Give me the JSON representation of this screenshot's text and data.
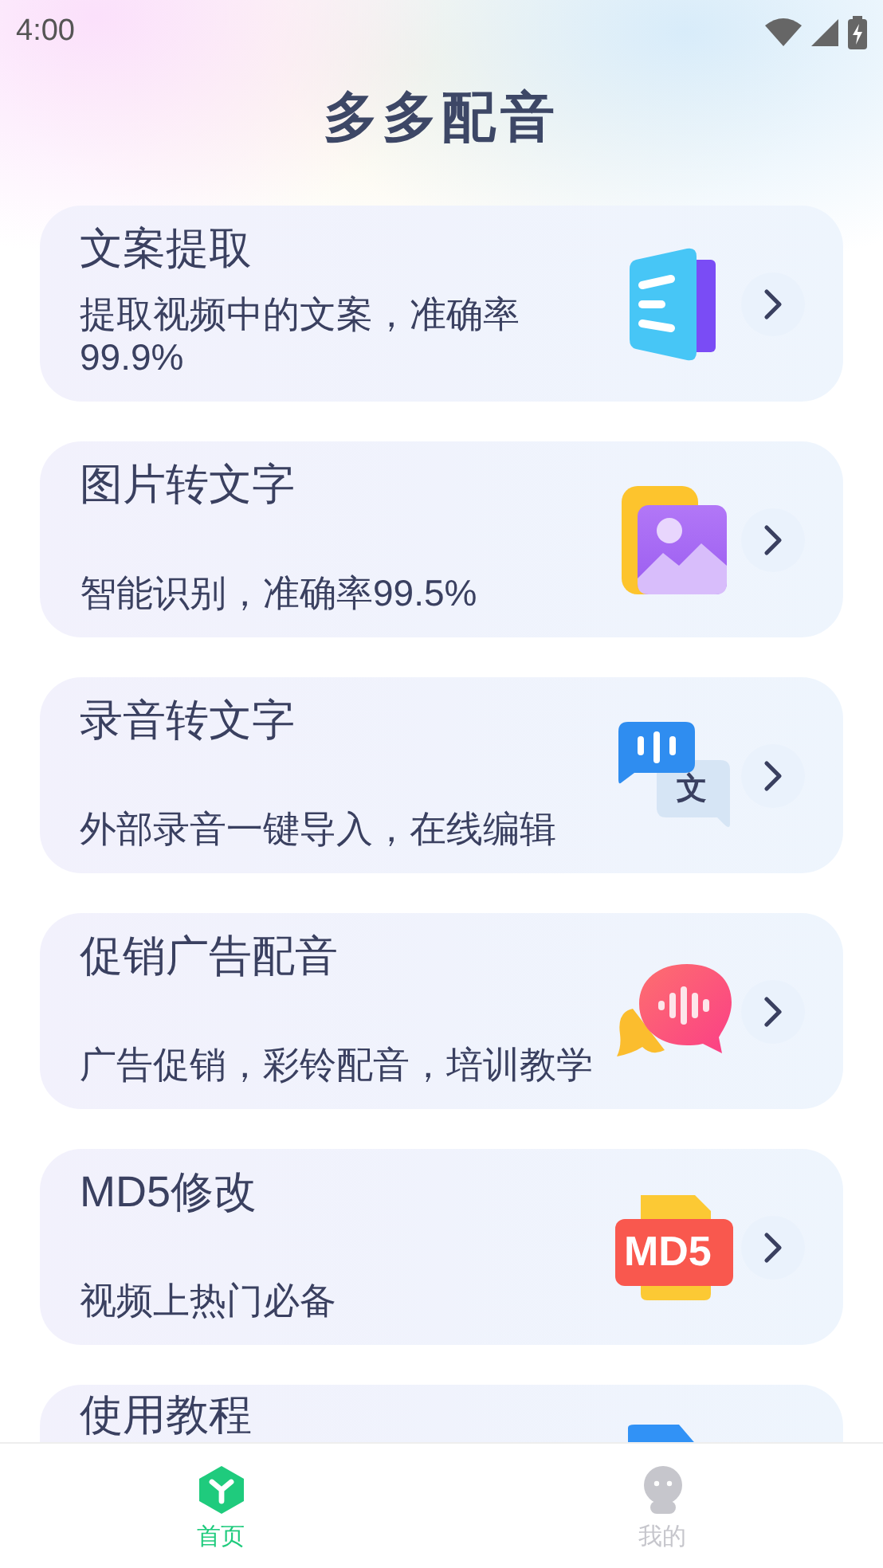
{
  "status_bar": {
    "time": "4:00"
  },
  "header": {
    "title": "多多配音"
  },
  "cards": [
    {
      "title": "文案提取",
      "subtitle": "提取视频中的文案，准确率99.9%",
      "kind": "document"
    },
    {
      "title": "图片转文字",
      "subtitle": "智能识别，准确率99.5%",
      "kind": "image"
    },
    {
      "title": "录音转文字",
      "subtitle": "外部录音一键导入，在线编辑",
      "kind": "translate",
      "icon_text": "文"
    },
    {
      "title": "促销广告配音",
      "subtitle": "广告促销，彩铃配音，培训教学",
      "kind": "voice"
    },
    {
      "title": "MD5修改",
      "subtitle": "视频上热门必备",
      "kind": "md5",
      "icon_text": "MD5"
    },
    {
      "title": "使用教程",
      "kind": "folder"
    }
  ],
  "bottom_nav": [
    {
      "label": "首页",
      "kind": "home",
      "selected": true
    },
    {
      "label": "我的",
      "kind": "profile",
      "selected": false
    }
  ]
}
